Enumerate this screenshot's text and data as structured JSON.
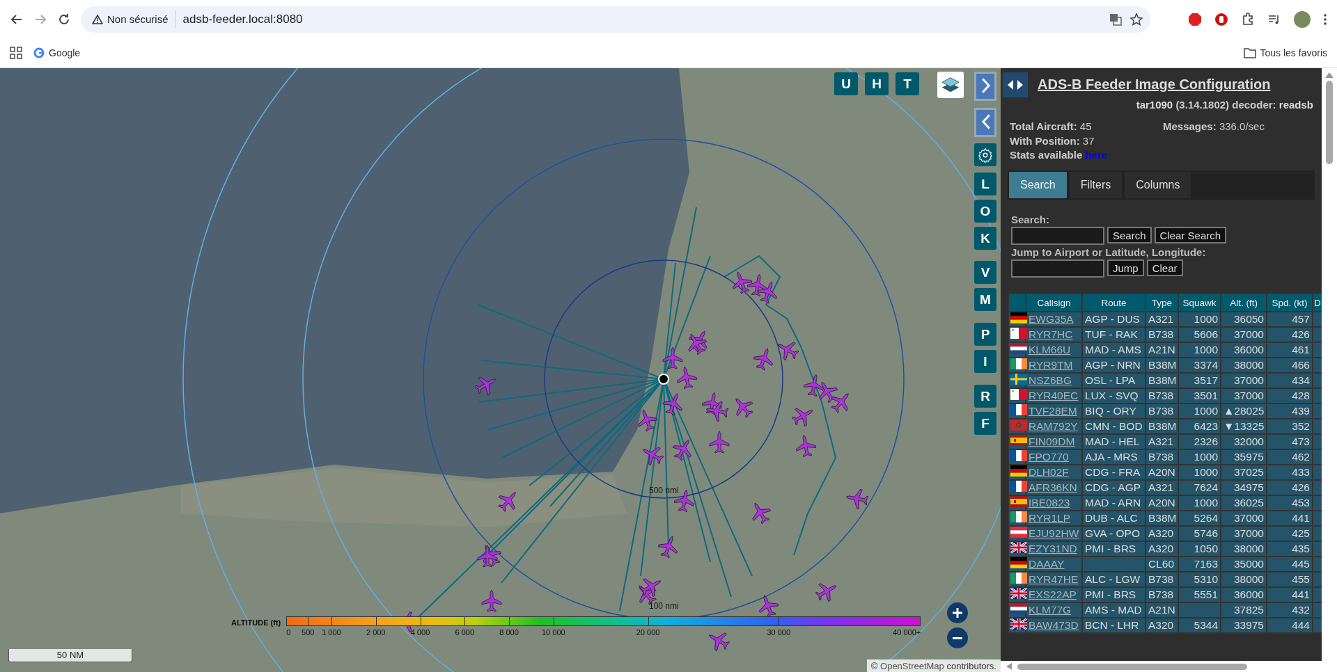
{
  "browser": {
    "security_label": "Non sécurisé",
    "url": "adsb-feeder.local:8080",
    "bookmarks": [
      "Google"
    ],
    "all_bookmarks": "Tous les favoris"
  },
  "map": {
    "top_buttons": [
      "U",
      "H",
      "T"
    ],
    "side_buttons": [
      {
        "kind": "next"
      },
      {
        "kind": "prev"
      },
      {
        "kind": "gear"
      },
      {
        "kind": "letter",
        "label": "L"
      },
      {
        "kind": "letter",
        "label": "O"
      },
      {
        "kind": "letter",
        "label": "K"
      },
      {
        "kind": "letter",
        "label": "V"
      },
      {
        "kind": "letter",
        "label": "M"
      },
      {
        "kind": "letter",
        "label": "P"
      },
      {
        "kind": "letter",
        "label": "I"
      },
      {
        "kind": "letter",
        "label": "R"
      },
      {
        "kind": "letter",
        "label": "F"
      }
    ],
    "ring_labels": [
      "500 nmi",
      "100 nmi"
    ],
    "legend": {
      "title": "ALTITUDE (ft)",
      "ticks": [
        "0",
        "500",
        "1 000",
        "2 000",
        "4 000",
        "6 000",
        "8 000",
        "10 000",
        "20 000",
        "30 000",
        "40 000+"
      ]
    },
    "scale": "50 NM",
    "attribution": {
      "prefix": "©",
      "link": "OpenStreetMap",
      "suffix": "contributors."
    }
  },
  "panel": {
    "title": "ADS-B Feeder Image Configuration",
    "app_link": "tar1090",
    "version": "(3.14.1802) decoder:",
    "decoder_link": "readsb",
    "stats": [
      {
        "label": "Total Aircraft:",
        "value": "45"
      },
      {
        "label": "Messages:",
        "value": "336.0/sec"
      },
      {
        "label": "With Position:",
        "value": "37"
      }
    ],
    "stats_text": "Stats available",
    "stats_link": "here",
    "tabs": [
      {
        "label": "Search",
        "selected": true
      },
      {
        "label": "Filters",
        "selected": false
      },
      {
        "label": "Columns",
        "selected": false
      }
    ],
    "search_label": "Search:",
    "search_buttons": [
      "Search",
      "Clear Search"
    ],
    "jump_label": "Jump to Airport or Latitude, Longitude:",
    "jump_buttons": [
      "Jump",
      "Clear"
    ],
    "table": {
      "columns": [
        "Callsign",
        "Route",
        "Type",
        "Squawk",
        "Alt. (ft)",
        "Spd. (kt)",
        "D"
      ],
      "rows": [
        {
          "flag": {
            "kind": "de"
          },
          "callsign": "EWG35A",
          "route": "AGP - DUS",
          "type": "A321",
          "squawk": "1000",
          "altitude": "36050",
          "speed": "457"
        },
        {
          "flag": {
            "kind": "mt"
          },
          "callsign": "RYR7HC",
          "route": "TUF - RAK",
          "type": "B738",
          "squawk": "5606",
          "altitude": "37000",
          "speed": "426"
        },
        {
          "flag": {
            "kind": "nl"
          },
          "callsign": "KLM66U",
          "route": "MAD - AMS",
          "type": "A21N",
          "squawk": "1000",
          "altitude": "36000",
          "speed": "461"
        },
        {
          "flag": {
            "kind": "ie"
          },
          "callsign": "RYR9TM",
          "route": "AGP - NRN",
          "type": "B38M",
          "squawk": "3374",
          "altitude": "38000",
          "speed": "466"
        },
        {
          "flag": {
            "kind": "se"
          },
          "callsign": "NSZ6BG",
          "route": "OSL - LPA",
          "type": "B38M",
          "squawk": "3517",
          "altitude": "37000",
          "speed": "434"
        },
        {
          "flag": {
            "kind": "mt"
          },
          "callsign": "RYR40EC",
          "route": "LUX - SVQ",
          "type": "B738",
          "squawk": "3501",
          "altitude": "37000",
          "speed": "428"
        },
        {
          "flag": {
            "kind": "fr"
          },
          "callsign": "TVF28EM",
          "route": "BIQ - ORY",
          "type": "B738",
          "squawk": "1000",
          "altitude": "▲28025",
          "speed": "439"
        },
        {
          "flag": {
            "kind": "ma"
          },
          "callsign": "RAM792Y",
          "route": "CMN - BOD",
          "type": "B38M",
          "squawk": "6423",
          "altitude": "▼13325",
          "speed": "352"
        },
        {
          "flag": {
            "kind": "es"
          },
          "callsign": "FIN09DM",
          "route": "MAD - HEL",
          "type": "A321",
          "squawk": "2326",
          "altitude": "32000",
          "speed": "473"
        },
        {
          "flag": {
            "kind": "fr"
          },
          "callsign": "FPO770",
          "route": "AJA - MRS",
          "type": "B738",
          "squawk": "1000",
          "altitude": "35975",
          "speed": "462"
        },
        {
          "flag": {
            "kind": "de"
          },
          "callsign": "DLH02F",
          "route": "CDG - FRA",
          "type": "A20N",
          "squawk": "1000",
          "altitude": "37025",
          "speed": "433"
        },
        {
          "flag": {
            "kind": "fr"
          },
          "callsign": "AFR36KN",
          "route": "CDG - AGP",
          "type": "A321",
          "squawk": "7624",
          "altitude": "34975",
          "speed": "426"
        },
        {
          "flag": {
            "kind": "es"
          },
          "callsign": "IBE0823",
          "route": "MAD - ARN",
          "type": "A20N",
          "squawk": "1000",
          "altitude": "36025",
          "speed": "453"
        },
        {
          "flag": {
            "kind": "ie"
          },
          "callsign": "RYR1LP",
          "route": "DUB - ALC",
          "type": "B38M",
          "squawk": "5264",
          "altitude": "37000",
          "speed": "441"
        },
        {
          "flag": {
            "kind": "at"
          },
          "callsign": "EJU92HW",
          "route": "GVA - OPO",
          "type": "A320",
          "squawk": "5746",
          "altitude": "37000",
          "speed": "425"
        },
        {
          "flag": {
            "kind": "gb"
          },
          "callsign": "EZY31ND",
          "route": "PMI - BRS",
          "type": "A320",
          "squawk": "1050",
          "altitude": "38000",
          "speed": "435"
        },
        {
          "flag": {
            "kind": "de"
          },
          "callsign": "DAAAY",
          "type": "CL60",
          "squawk": "7163",
          "altitude": "35000",
          "speed": "445"
        },
        {
          "flag": {
            "kind": "ie"
          },
          "callsign": "RYR47HE",
          "route": "ALC - LGW",
          "type": "B738",
          "squawk": "5310",
          "altitude": "38000",
          "speed": "455"
        },
        {
          "flag": {
            "kind": "gb"
          },
          "callsign": "EXS22AP",
          "route": "PMI - BRS",
          "type": "B738",
          "squawk": "5551",
          "altitude": "36000",
          "speed": "441"
        },
        {
          "flag": {
            "kind": "nl"
          },
          "callsign": "KLM77G",
          "route": "AMS - MAD",
          "type": "A21N",
          "altitude": "37825",
          "speed": "432"
        },
        {
          "flag": {
            "kind": "gb"
          },
          "callsign": "BAW473D",
          "route": "BCN - LHR",
          "type": "A320",
          "squawk": "5344",
          "altitude": "33975",
          "speed": "444"
        }
      ]
    }
  }
}
